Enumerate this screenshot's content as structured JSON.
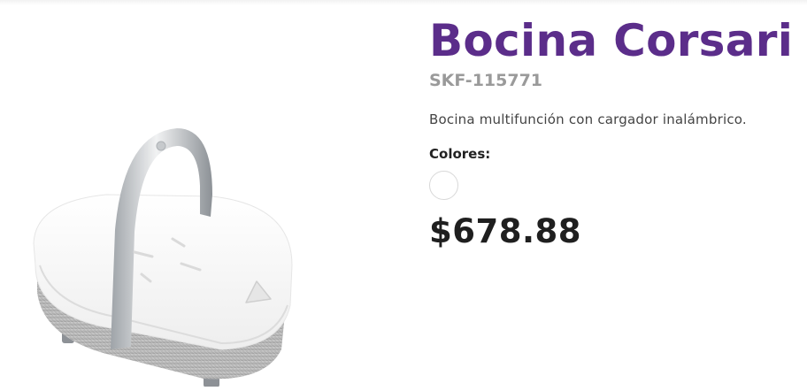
{
  "product": {
    "title": "Bocina Corsari",
    "sku": "SKF-115771",
    "description": "Bocina multifunción con cargador inalámbrico.",
    "colors_label": "Colores:",
    "colors": [
      {
        "name": "Blanco",
        "hex": "#ffffff"
      }
    ],
    "price": "$678.88",
    "image_icon": "speaker-product-image"
  },
  "theme": {
    "title_color": "#5b2d8a",
    "sku_color": "#9a9a9a",
    "price_color": "#1f1f1f"
  }
}
